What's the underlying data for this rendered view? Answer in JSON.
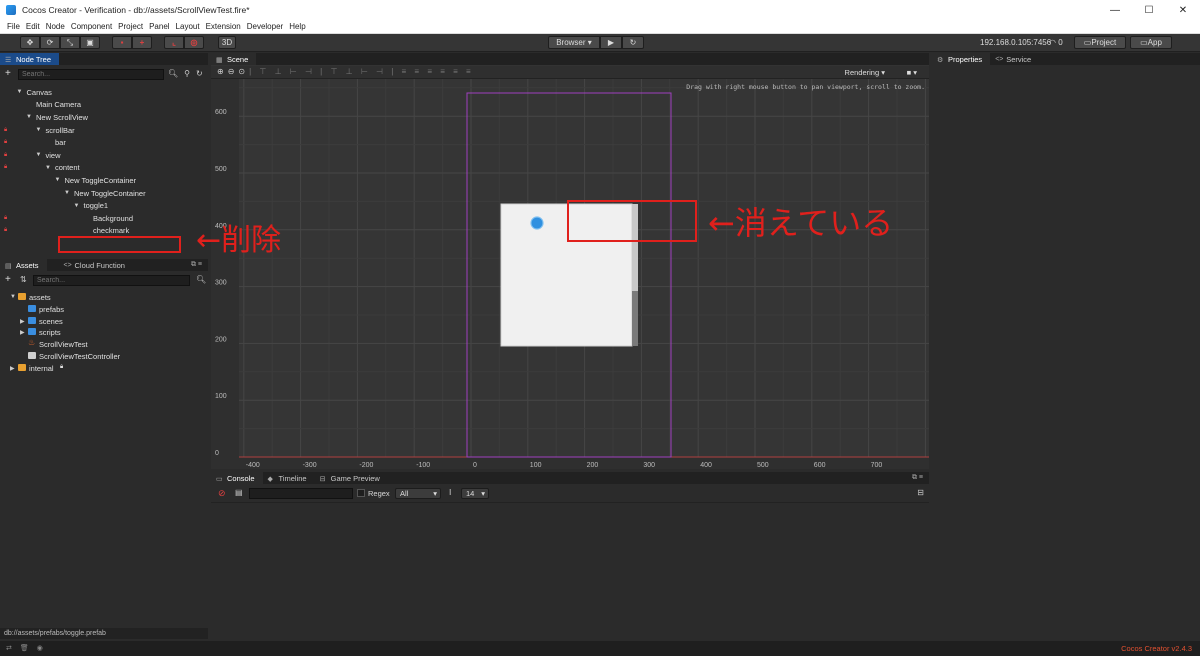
{
  "window": {
    "title": "Cocos Creator - Verification - db://assets/ScrollViewTest.fire*",
    "minimize": "—",
    "maximize": "☐",
    "close": "✕"
  },
  "menu": [
    "File",
    "Edit",
    "Node",
    "Component",
    "Project",
    "Panel",
    "Layout",
    "Extension",
    "Developer",
    "Help"
  ],
  "toolbar": {
    "btn_3d": "3D",
    "browser": "Browser ▾",
    "ip": "192.168.0.105:7456",
    "wifi_count": "0",
    "project": "Project",
    "app": "App"
  },
  "node_tree": {
    "tab": "Node Tree",
    "search_placeholder": "Search...",
    "nodes": [
      {
        "label": "Canvas",
        "level": 1,
        "expanded": true,
        "locked": false
      },
      {
        "label": "Main Camera",
        "level": 2,
        "expanded": null,
        "locked": false
      },
      {
        "label": "New ScrollView",
        "level": 2,
        "expanded": true,
        "locked": false
      },
      {
        "label": "scrollBar",
        "level": 3,
        "expanded": true,
        "locked": true
      },
      {
        "label": "bar",
        "level": 4,
        "expanded": null,
        "locked": true
      },
      {
        "label": "view",
        "level": 3,
        "expanded": true,
        "locked": true
      },
      {
        "label": "content",
        "level": 4,
        "expanded": true,
        "locked": true
      },
      {
        "label": "New ToggleContainer",
        "level": 5,
        "expanded": true,
        "locked": false
      },
      {
        "label": "New ToggleContainer",
        "level": 6,
        "expanded": true,
        "locked": false
      },
      {
        "label": "toggle1",
        "level": 7,
        "expanded": true,
        "locked": false
      },
      {
        "label": "Background",
        "level": 8,
        "expanded": null,
        "locked": true
      },
      {
        "label": "checkmark",
        "level": 8,
        "expanded": null,
        "locked": true
      }
    ]
  },
  "assets": {
    "tab": "Assets",
    "tab2": "Cloud Function",
    "search_placeholder": "Search...",
    "items": [
      {
        "label": "assets",
        "level": 0,
        "type": "root",
        "expanded": true
      },
      {
        "label": "prefabs",
        "level": 1,
        "type": "folder",
        "expanded": null
      },
      {
        "label": "scenes",
        "level": 1,
        "type": "folder",
        "expanded": false
      },
      {
        "label": "scripts",
        "level": 1,
        "type": "folder",
        "expanded": false
      },
      {
        "label": "ScrollViewTest",
        "level": 1,
        "type": "fire",
        "expanded": null
      },
      {
        "label": "ScrollViewTestController",
        "level": 1,
        "type": "js",
        "expanded": null
      },
      {
        "label": "internal",
        "level": 0,
        "type": "root-locked",
        "expanded": false
      }
    ],
    "status": "db://assets/prefabs/toggle.prefab"
  },
  "scene": {
    "tab": "Scene",
    "rendering": "Rendering ▾",
    "hint": "Drag with right mouse button to pan viewport, scroll to zoom.",
    "y_labels": [
      "600",
      "500",
      "400",
      "300",
      "200",
      "100",
      "0"
    ],
    "x_labels": [
      "-400",
      "-300",
      "-200",
      "-100",
      "0",
      "100",
      "200",
      "300",
      "400",
      "500",
      "600",
      "700"
    ]
  },
  "console": {
    "tab": "Console",
    "tab2": "Timeline",
    "tab3": "Game Preview",
    "regex": "Regex",
    "level": "All",
    "font_size": "14"
  },
  "properties": {
    "tab": "Properties",
    "tab2": "Service"
  },
  "status_bar": {
    "version": "Cocos Creator v2.4.3"
  },
  "annotations": {
    "deleted": "←削除",
    "disappeared": "←消えている"
  },
  "colors": {
    "annotation": "#e0201c",
    "selected_tab": "#1b4b8a",
    "canvas_frame": "#a040c0",
    "version_text": "#e05030"
  }
}
